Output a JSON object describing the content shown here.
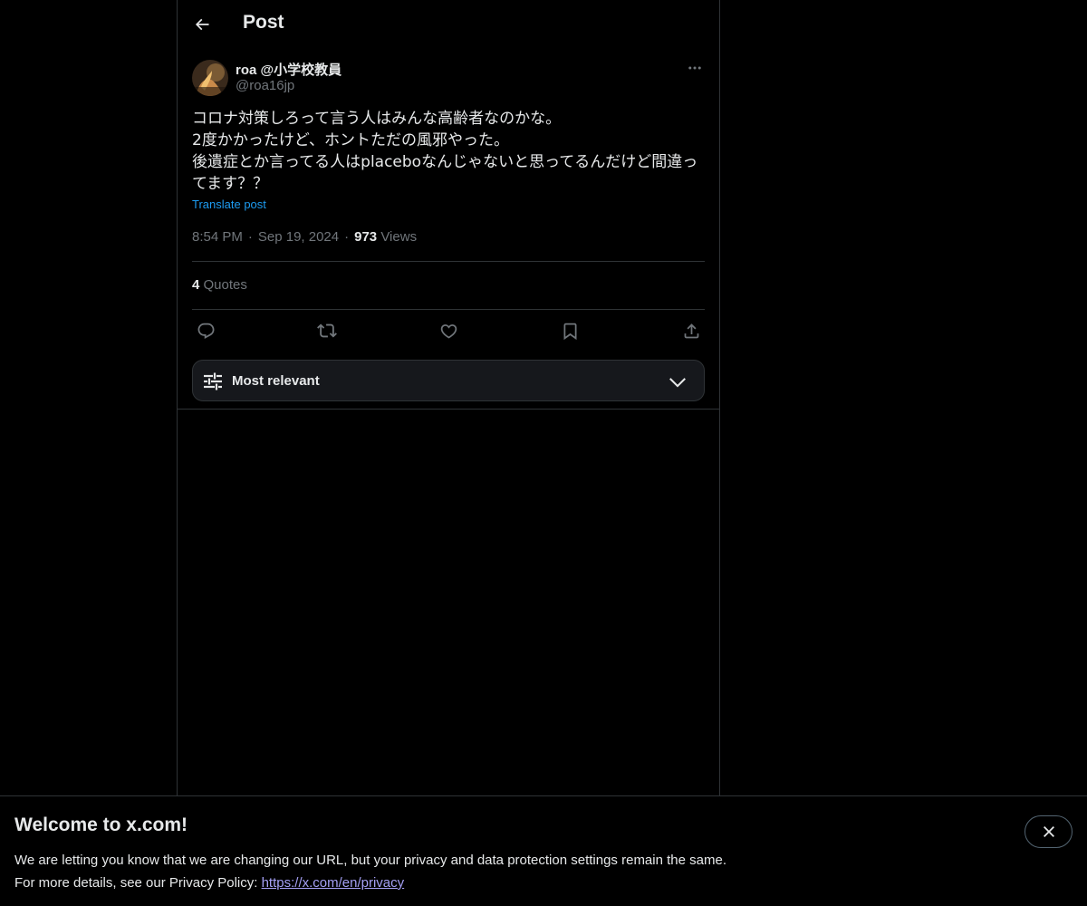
{
  "header": {
    "title": "Post",
    "back_icon": "arrow-left-icon"
  },
  "post": {
    "author_name": "roa @小学校教員",
    "author_handle": "@roa16jp",
    "text_lines": [
      "コロナ対策しろって言う人はみんな高齢者なのかな。",
      "2度かかったけど、ホントただの風邪やった。",
      "後遺症とか言ってる人はplaceboなんじゃないと思ってるんだけど間違っ",
      "てます？？"
    ],
    "translate_label": "Translate post",
    "time": "8:54 PM",
    "separator": "·",
    "date": "Sep 19, 2024",
    "views_count": "973",
    "views_label": "Views",
    "quotes_count": "4",
    "quotes_label": "Quotes"
  },
  "actions": [
    {
      "name": "reply",
      "icon": "reply-icon"
    },
    {
      "name": "repost",
      "icon": "repost-icon"
    },
    {
      "name": "like",
      "icon": "heart-icon"
    },
    {
      "name": "bookmark",
      "icon": "bookmark-icon"
    },
    {
      "name": "share",
      "icon": "share-icon"
    }
  ],
  "sort": {
    "label": "Most relevant"
  },
  "banner": {
    "title": "Welcome to x.com!",
    "line1": "We are letting you know that we are changing our URL, but your privacy and data protection settings remain the same.",
    "line2_prefix": "For more details, see our Privacy Policy: ",
    "link": "https://x.com/en/privacy"
  },
  "colors": {
    "background": "#000000",
    "text": "#e7e9ea",
    "muted": "#71767b",
    "accent": "#1d9bf0",
    "border": "#2f3336"
  }
}
